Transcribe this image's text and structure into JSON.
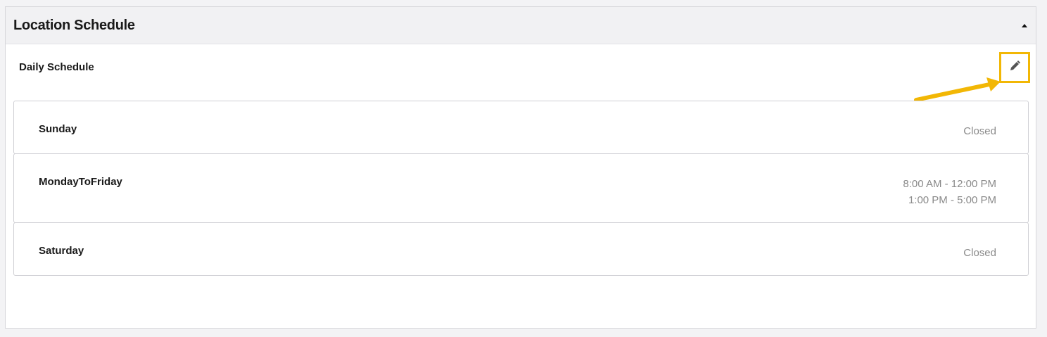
{
  "header": {
    "title": "Location Schedule",
    "toggle_icon": "triangle-up-icon"
  },
  "section": {
    "label": "Daily Schedule",
    "edit_icon": "pencil-icon",
    "highlight_color": "#f2b705"
  },
  "schedule": [
    {
      "day": "Sunday",
      "hours": [
        "Closed"
      ]
    },
    {
      "day": "MondayToFriday",
      "hours": [
        "8:00 AM - 12:00 PM",
        "1:00 PM - 5:00 PM"
      ]
    },
    {
      "day": "Saturday",
      "hours": [
        "Closed"
      ]
    }
  ]
}
